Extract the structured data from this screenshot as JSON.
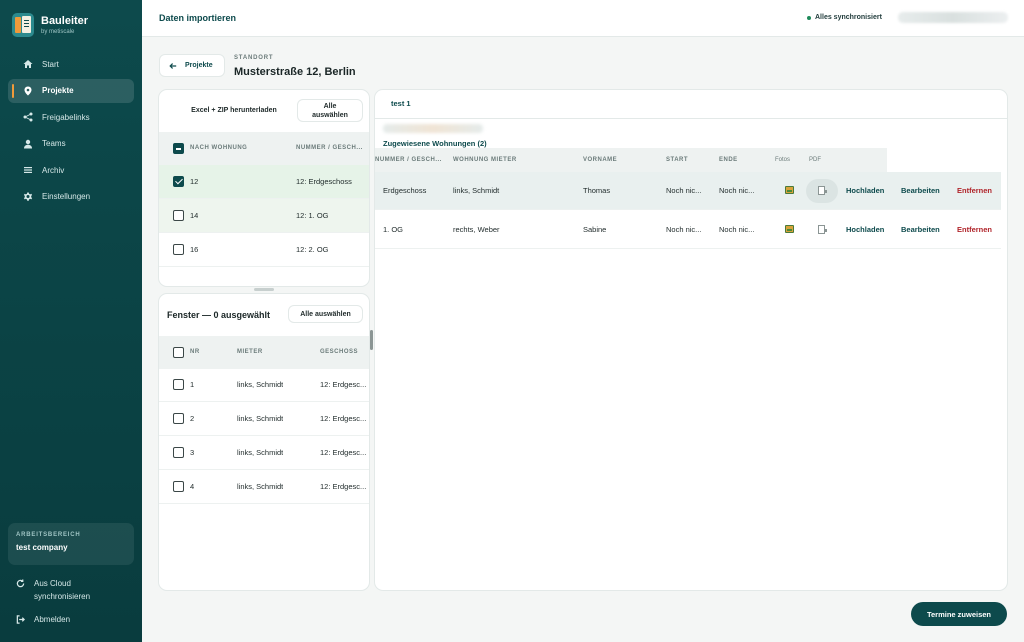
{
  "brand": {
    "title": "Bauleiter",
    "subtitle": "by metiscale"
  },
  "sidebar": {
    "items": [
      {
        "label": "Start",
        "icon": "home-icon"
      },
      {
        "label": "Projekte",
        "icon": "map-pin-icon",
        "active": true
      },
      {
        "label": "Freigabelinks",
        "icon": "share-icon"
      },
      {
        "label": "Teams",
        "icon": "user-icon"
      },
      {
        "label": "Archiv",
        "icon": "archive-icon"
      },
      {
        "label": "Einstellungen",
        "icon": "gear-icon"
      }
    ],
    "workspace": {
      "label": "ARBEITSBEREICH",
      "name": "test company"
    },
    "sync_line1": "Aus Cloud",
    "sync_line2": "synchronisieren",
    "logout": "Abmelden"
  },
  "topbar": {
    "title": "Daten importieren",
    "sync_status": "Alles synchronisiert"
  },
  "header": {
    "back_label": "Projekte",
    "location_label": "STANDORT",
    "location_title": "Musterstraße 12, Berlin"
  },
  "units_panel": {
    "download_label": "Excel + ZIP herunterladen",
    "select_all_line1": "Alle",
    "select_all_line2": "auswählen",
    "columns": [
      "NACH WOHNUNG",
      "NUMMER / GESCH..."
    ],
    "rows": [
      {
        "nr": "12",
        "floor": "12: Erdgeschoss",
        "checked": true
      },
      {
        "nr": "14",
        "floor": "12: 1. OG",
        "checked": false
      },
      {
        "nr": "16",
        "floor": "12: 2. OG",
        "checked": false
      }
    ]
  },
  "windows_panel": {
    "title": "Fenster — 0 ausgewählt",
    "select_all": "Alle auswählen",
    "columns": [
      "NR",
      "MIETER",
      "GESCHOSS"
    ],
    "rows": [
      {
        "nr": "1",
        "tenant": "links, Schmidt",
        "floor": "12: Erdgesc..."
      },
      {
        "nr": "2",
        "tenant": "links, Schmidt",
        "floor": "12: Erdgesc..."
      },
      {
        "nr": "3",
        "tenant": "links, Schmidt",
        "floor": "12: Erdgesc..."
      },
      {
        "nr": "4",
        "tenant": "links, Schmidt",
        "floor": "12: Erdgesc..."
      }
    ]
  },
  "main_panel": {
    "tab": "test 1",
    "assigned_title": "Zugewiesene Wohnungen (2)",
    "columns": [
      "NUMMER / GESCH...",
      "WOHNUNG MIETER",
      "VORNAME",
      "START",
      "ENDE",
      "Fotos",
      "PDF"
    ],
    "rows": [
      {
        "floor": "Erdgeschoss",
        "tenant": "links, Schmidt",
        "firstname": "Thomas",
        "start": "Noch nic...",
        "end": "Noch nic...",
        "upload": "Hochladen",
        "edit": "Bearbeiten",
        "remove": "Entfernen"
      },
      {
        "floor": "1. OG",
        "tenant": "rechts, Weber",
        "firstname": "Sabine",
        "start": "Noch nic...",
        "end": "Noch nic...",
        "upload": "Hochladen",
        "edit": "Bearbeiten",
        "remove": "Entfernen"
      }
    ]
  },
  "footer": {
    "assign_button": "Termine zuweisen"
  }
}
